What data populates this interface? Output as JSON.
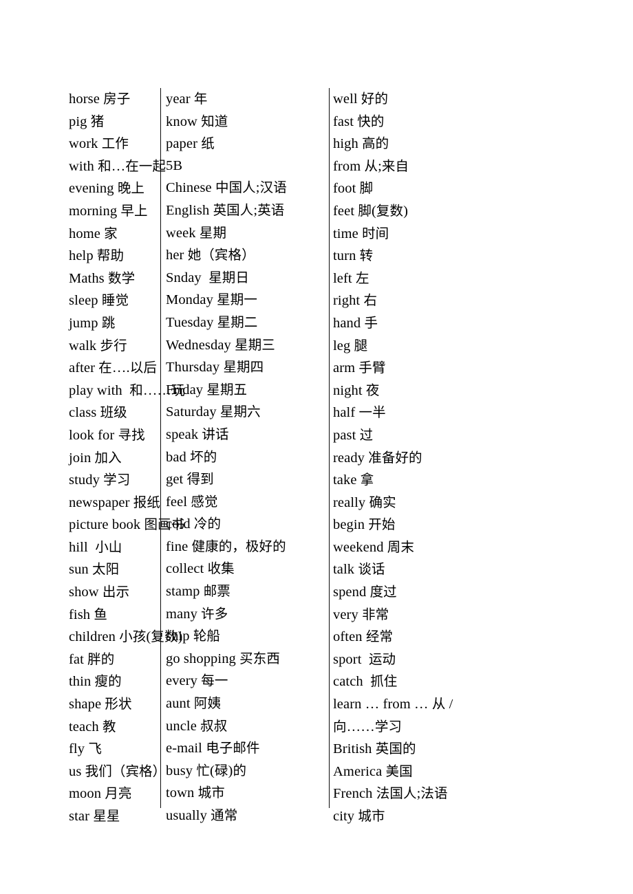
{
  "document": {
    "type": "vocabulary-word-list",
    "language_pair": "English-Chinese",
    "column_count": 3
  },
  "columns": [
    {
      "id": "column-1",
      "entries": [
        "horse 房子",
        "pig 猪",
        "work 工作",
        "with 和…在一起",
        "evening 晚上",
        "morning 早上",
        "home 家",
        "help 帮助",
        "Maths 数学",
        "sleep 睡觉",
        "jump 跳",
        "walk 步行",
        "after 在….以后",
        "play with  和……玩",
        "class 班级",
        "look for 寻找",
        "join 加入",
        "study 学习",
        "newspaper 报纸",
        "picture book 图画书",
        "hill  小山",
        "sun 太阳",
        "show 出示",
        "fish 鱼",
        "children 小孩(复数)",
        "fat 胖的",
        "thin 瘦的",
        "shape 形状",
        "teach 教",
        "fly 飞",
        "us 我们（宾格）",
        "moon 月亮",
        "star 星星"
      ]
    },
    {
      "id": "column-2",
      "entries": [
        "year 年",
        "know 知道",
        "paper 纸",
        "5B",
        "Chinese 中国人;汉语",
        "English 英国人;英语",
        "week 星期",
        "her 她（宾格）",
        "Snday  星期日",
        "Monday 星期一",
        "Tuesday 星期二",
        "Wednesday 星期三",
        "Thursday 星期四",
        "Friday 星期五",
        "Saturday 星期六",
        "speak 讲话",
        "bad 坏的",
        "get 得到",
        "feel 感觉",
        "cold 冷的",
        "fine 健康的，极好的",
        "collect 收集",
        "stamp 邮票",
        "many 许多",
        "ship 轮船",
        "go shopping 买东西",
        "every 每一",
        "aunt 阿姨",
        "uncle 叔叔",
        "e-mail 电子邮件",
        "busy 忙(碌)的",
        "town 城市",
        "usually 通常"
      ]
    },
    {
      "id": "column-3",
      "entries": [
        "well 好的",
        "fast 快的",
        "high 高的",
        "from 从;来自",
        "foot 脚",
        "feet 脚(复数)",
        "time 时间",
        "turn 转",
        "left 左",
        "right 右",
        "hand 手",
        "leg 腿",
        "arm 手臂",
        "night 夜",
        "half 一半",
        "past 过",
        "ready 准备好的",
        "take 拿",
        "really 确实",
        "begin 开始",
        "weekend 周末",
        "talk 谈话",
        "spend 度过",
        "very 非常",
        "often 经常",
        "sport  运动",
        "catch  抓住",
        "learn … from … 从 /\n向……学习",
        "British 英国的",
        "America 美国",
        "French 法国人;法语",
        "city 城市"
      ]
    }
  ]
}
